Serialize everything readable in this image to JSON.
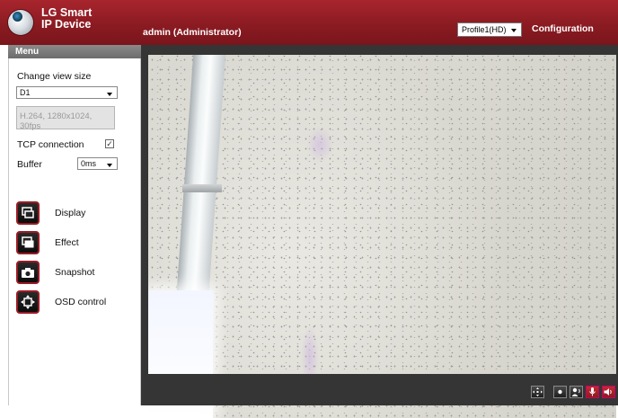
{
  "header": {
    "brand_line1": "LG Smart",
    "brand_line2": "IP Device",
    "user": "admin (Administrator)",
    "profile_selected": "Profile1(HD)",
    "configuration_label": "Configuration",
    "accent_color": "#8b1b22"
  },
  "sidebar": {
    "menu_title": "Menu",
    "view_size_label": "Change view size",
    "view_size_value": "D1",
    "stream_info": "H.264, 1280x1024, 30fps",
    "tcp_label": "TCP connection",
    "tcp_checked": true,
    "tcp_check_mark": "✓",
    "buffer_label": "Buffer",
    "buffer_value": "0ms",
    "tools": [
      {
        "label": "Display",
        "icon": "display-icon"
      },
      {
        "label": "Effect",
        "icon": "effect-icon"
      },
      {
        "label": "Snapshot",
        "icon": "camera-icon"
      },
      {
        "label": "OSD control",
        "icon": "osd-move-icon"
      }
    ]
  },
  "controls": {
    "buttons": [
      "ptz-icon",
      "record-icon",
      "talk-icon",
      "microphone-icon",
      "speaker-icon"
    ]
  }
}
